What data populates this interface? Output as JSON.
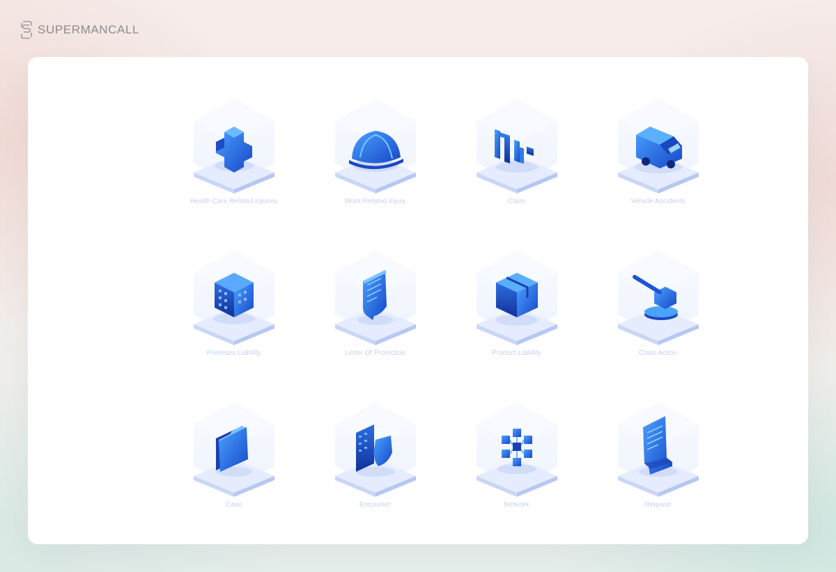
{
  "brand": {
    "name": "SUPERMANCALL"
  },
  "colors": {
    "accent": "#2f7ae8",
    "label": "#c6d1ea"
  },
  "items": [
    {
      "label": "Health Care Related Injuries",
      "icon": "medical-cross-icon"
    },
    {
      "label": "Work Related Injury",
      "icon": "hard-hat-icon"
    },
    {
      "label": "Claim",
      "icon": "claim-letters-icon"
    },
    {
      "label": "Vehicle Accidents",
      "icon": "van-icon"
    },
    {
      "label": "Premises Liability",
      "icon": "building-icon"
    },
    {
      "label": "Letter Of Protection",
      "icon": "document-scroll-icon"
    },
    {
      "label": "Product Liability",
      "icon": "package-box-icon"
    },
    {
      "label": "Class Action",
      "icon": "gavel-icon"
    },
    {
      "label": "Case",
      "icon": "folder-icon"
    },
    {
      "label": "Encounter",
      "icon": "report-shield-icon"
    },
    {
      "label": "Network",
      "icon": "network-cubes-icon"
    },
    {
      "label": "Request",
      "icon": "receipt-icon"
    }
  ]
}
